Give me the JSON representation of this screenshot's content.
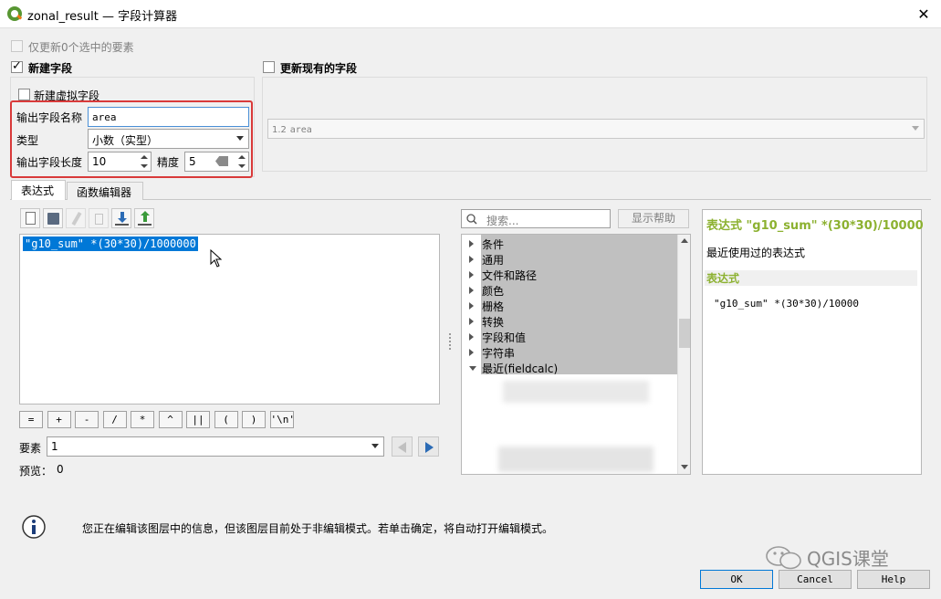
{
  "window": {
    "title": "zonal_result — 字段计算器",
    "close": "✕"
  },
  "only_update_selected": {
    "label": "仅更新0个选中的要素"
  },
  "new_field": {
    "label": "新建字段",
    "virtual_label": "新建虚拟字段",
    "name_label": "输出字段名称",
    "name_value": "area",
    "type_label": "类型",
    "type_value": "小数（实型）",
    "length_label": "输出字段长度",
    "length_value": "10",
    "precision_label": "精度",
    "precision_value": "5"
  },
  "update_existing": {
    "label": "更新现有的字段",
    "field_prefix": "1.2",
    "field_value": "area"
  },
  "tabs": [
    {
      "label": "表达式"
    },
    {
      "label": "函数编辑器"
    }
  ],
  "toolbar": {
    "icons": [
      "new-file-icon",
      "save-icon",
      "edit-icon",
      "delete-icon",
      "import-icon",
      "export-icon"
    ]
  },
  "expression": {
    "text": "\"g10_sum\" *(30*30)/1000000"
  },
  "operators": [
    "=",
    "+",
    "-",
    "/",
    "*",
    "^",
    "||",
    "(",
    ")",
    "'\\n'"
  ],
  "feature": {
    "label": "要素",
    "value": "1"
  },
  "preview": {
    "label": "预览：",
    "value": "0"
  },
  "search": {
    "placeholder": "搜索..."
  },
  "show_help": "显示帮助",
  "tree": [
    {
      "label": "条件"
    },
    {
      "label": "通用"
    },
    {
      "label": "文件和路径"
    },
    {
      "label": "颜色"
    },
    {
      "label": "栅格"
    },
    {
      "label": "转换"
    },
    {
      "label": "字段和值"
    },
    {
      "label": "字符串"
    },
    {
      "label": "最近(fieldcalc)"
    }
  ],
  "help": {
    "title": "表达式 \"g10_sum\" *(30*30)/10000",
    "subtitle": "最近使用过的表达式",
    "section": "表达式",
    "code": "\"g10_sum\" *(30*30)/10000"
  },
  "info": {
    "message": "您正在编辑该图层中的信息，但该图层目前处于非编辑模式。若单击确定，将自动打开编辑模式。"
  },
  "watermark": "QGIS课堂",
  "buttons": {
    "ok": "OK",
    "cancel": "Cancel",
    "help": "Help"
  },
  "colors": {
    "accent_green": "#8cb130",
    "highlight_blue": "#0078d7",
    "annotation_red": "#d93a3a"
  }
}
